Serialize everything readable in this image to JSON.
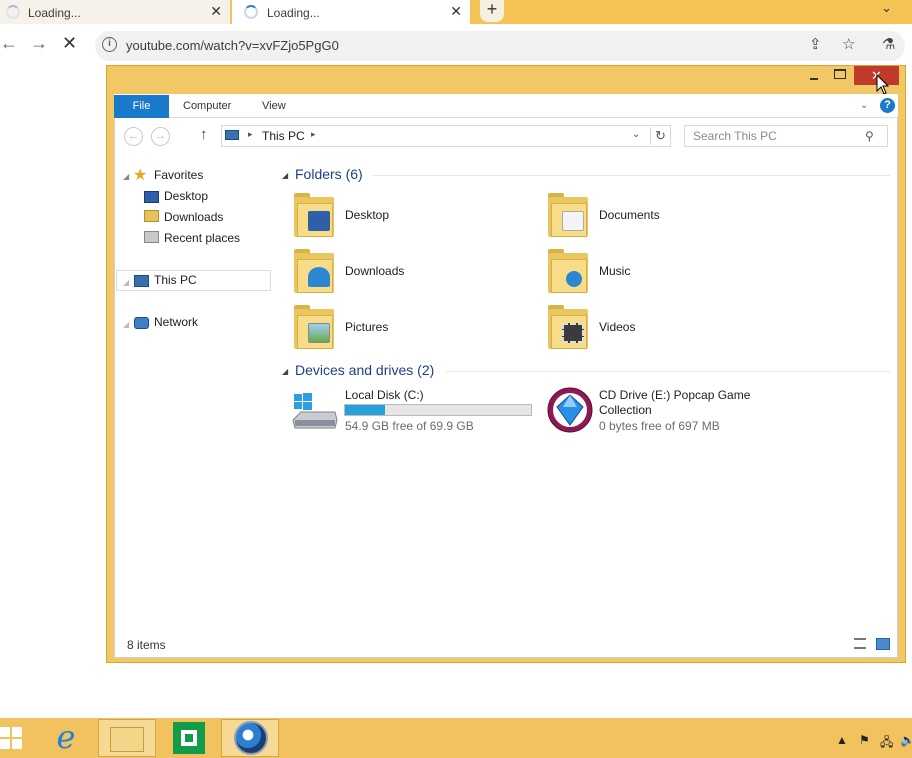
{
  "browser": {
    "tabs": [
      {
        "title": "Loading...",
        "close": "✕",
        "active": false
      },
      {
        "title": "Loading...",
        "close": "✕",
        "active": true
      }
    ],
    "new_tab_label": "+",
    "tab_menu_label": "⌄",
    "back_label": "←",
    "forward_label": "→",
    "reload_label": "✕",
    "info_label": "i",
    "url": "youtube.com/watch?v=xvFZjo5PgG0",
    "share_label": "⇪",
    "star_label": "☆",
    "extension_label": "⚗"
  },
  "window": {
    "min_label": "",
    "close_label": "✕",
    "ribbon_tabs": [
      "File",
      "Computer",
      "View"
    ],
    "ribbon_chevron": "⌄",
    "help_label": "?"
  },
  "address": {
    "back_label": "←",
    "forward_label": "→",
    "up_label": "↑",
    "sep": "▸",
    "location": "This PC",
    "dropdown_label": "⌄",
    "refresh_label": "↻",
    "search_placeholder": "Search This PC",
    "search_icon": "⚲"
  },
  "nav": {
    "favorites": "Favorites",
    "favorite_items": [
      "Desktop",
      "Downloads",
      "Recent places"
    ],
    "this_pc": "This PC",
    "network": "Network",
    "expander": "◢",
    "star": "★"
  },
  "content": {
    "folders_header": "Folders (6)",
    "folders": [
      "Desktop",
      "Documents",
      "Downloads",
      "Music",
      "Pictures",
      "Videos"
    ],
    "devices_header": "Devices and drives (2)",
    "group_arrow": "◢",
    "drives": [
      {
        "name": "Local Disk (C:)",
        "free": "54.9 GB free of 69.9 GB",
        "used_fraction": 0.215
      },
      {
        "name_line1": "CD Drive (E:) Popcap Game",
        "name_line2": "Collection",
        "free": "0 bytes free of 697 MB"
      }
    ]
  },
  "status": {
    "items": "8 items"
  },
  "taskbar": {
    "ie_glyph": "e",
    "tray": [
      "▲",
      "⚑",
      "🖧",
      "🔈"
    ]
  },
  "colors": {
    "accent": "#1979ca",
    "window_frame": "#f2c866",
    "close_button": "#c0392b",
    "taskbar": "#f1c25e",
    "drive_bar": "#26a0da"
  },
  "icons": [
    "pc-icon",
    "folder-icon",
    "drive-icon",
    "cd-icon",
    "ie-icon",
    "store-icon"
  ]
}
